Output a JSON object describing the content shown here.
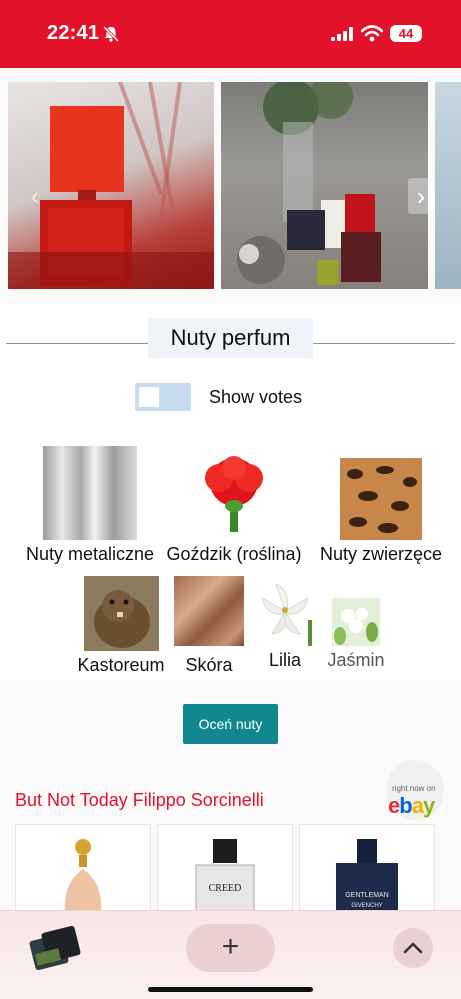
{
  "status_bar": {
    "time": "22:41",
    "battery": "44",
    "bg_color": "#e2122a"
  },
  "gallery": {
    "images": [
      "perfume-bottle-red-photo",
      "perfume-bottles-with-plant-photo",
      "partial-image"
    ],
    "prev_icon": "chevron-left-icon",
    "next_icon": "chevron-right-icon"
  },
  "notes": {
    "title": "Nuty perfum",
    "show_votes_label": "Show votes",
    "items": [
      {
        "label": "Nuty metaliczne",
        "image": "metallic-texture"
      },
      {
        "label": "Goździk (roślina)",
        "image": "red-carnation-flower"
      },
      {
        "label": "Nuty zwierzęce",
        "image": "leopard-fur-texture"
      },
      {
        "label": "Kastoreum",
        "image": "beaver-photo"
      },
      {
        "label": "Skóra",
        "image": "brown-leather-texture"
      },
      {
        "label": "Lilia",
        "image": "white-lily-flower"
      },
      {
        "label": "Jaśmin",
        "image": "jasmine-flower"
      }
    ],
    "rate_button": "Oceń nuty",
    "rate_button_color": "#11878f"
  },
  "ad": {
    "title": "But Not Today Filippo Sorcinelli",
    "title_color": "#e2122a",
    "ebay_logo": "ebay",
    "badge_text": "right now on",
    "cards": [
      "pink-perfume-bottle",
      "creed-perfume-bottle",
      "gentleman-givenchy-bottle"
    ],
    "card_texts": [
      "CREED",
      "GENTLEMAN",
      "GIVENCHY"
    ]
  },
  "bottom_bar": {
    "tabs_icon": "tabs-icon",
    "plus_label": "+",
    "up_icon": "chevron-up-icon"
  }
}
